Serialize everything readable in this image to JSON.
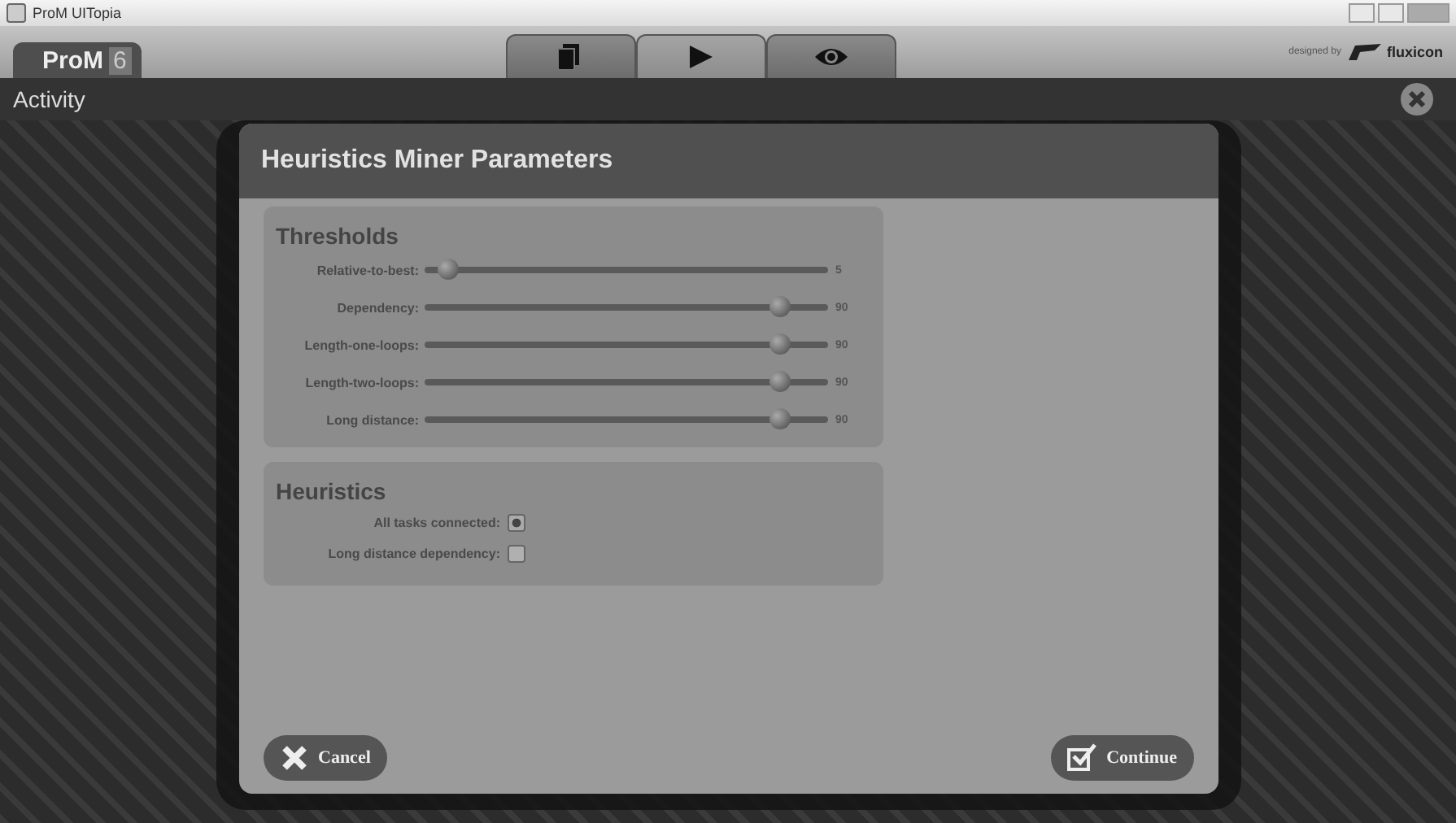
{
  "window": {
    "title": "ProM UITopia"
  },
  "app": {
    "logo": "ProM",
    "version": "6",
    "credit": "designed by",
    "brand": "fluxicon"
  },
  "toolbar": [
    {
      "kind": "workspace",
      "selected": false
    },
    {
      "kind": "action",
      "selected": true
    },
    {
      "kind": "view",
      "selected": false
    }
  ],
  "activity": {
    "title": "Activity"
  },
  "dialog": {
    "title": "Heuristics Miner Parameters",
    "thresholds": {
      "title": "Thresholds",
      "sliders": [
        {
          "label": "Relative-to-best:",
          "level": 0.06,
          "reading": "5"
        },
        {
          "label": "Dependency:",
          "level": 0.88,
          "reading": "90"
        },
        {
          "label": "Length-one-loops:",
          "level": 0.88,
          "reading": "90"
        },
        {
          "label": "Length-two-loops:",
          "level": 0.88,
          "reading": "90"
        },
        {
          "label": "Long distance:",
          "level": 0.88,
          "reading": "90"
        }
      ]
    },
    "heuristics": {
      "title": "Heuristics",
      "options": [
        {
          "label": "All tasks connected:",
          "checked": true
        },
        {
          "label": "Long distance dependency:",
          "checked": false
        }
      ]
    },
    "buttons": [
      {
        "kind": "cancel",
        "label": "Cancel"
      },
      {
        "kind": "continue",
        "label": "Continue"
      }
    ]
  }
}
